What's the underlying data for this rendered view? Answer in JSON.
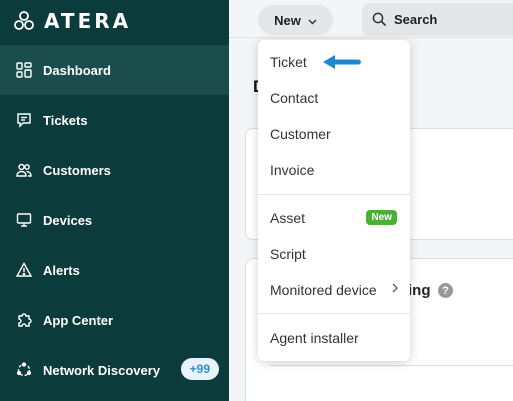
{
  "brand": {
    "name": "ATERA",
    "logo_icon": "atera-trefoil-icon"
  },
  "sidebar": {
    "items": [
      {
        "label": "Dashboard",
        "icon": "dashboard-icon",
        "active": true
      },
      {
        "label": "Tickets",
        "icon": "ticket-chat-icon"
      },
      {
        "label": "Customers",
        "icon": "customers-icon"
      },
      {
        "label": "Devices",
        "icon": "monitor-icon"
      },
      {
        "label": "Alerts",
        "icon": "warning-triangle-icon"
      },
      {
        "label": "App Center",
        "icon": "puzzle-icon"
      },
      {
        "label": "Network Discovery",
        "icon": "network-icon",
        "badge": "+99"
      }
    ]
  },
  "topbar": {
    "new_label": "New",
    "search_label": "Search"
  },
  "main": {
    "heading_fragment": "D",
    "card_title_fragment": "ing",
    "help_glyph": "?"
  },
  "new_menu": {
    "items": [
      {
        "label": "Ticket"
      },
      {
        "label": "Contact"
      },
      {
        "label": "Customer"
      },
      {
        "label": "Invoice"
      },
      {
        "label": "Asset",
        "tag": "New"
      },
      {
        "label": "Script"
      },
      {
        "label": "Monitored device",
        "has_submenu": true
      },
      {
        "label": "Agent installer"
      }
    ]
  },
  "colors": {
    "sidebar_bg": "#0c3b3b",
    "sidebar_active": "#1b4d4d",
    "new_tag": "#4caf35",
    "badge_text": "#2b8fd6",
    "arrow": "#1f86d0"
  }
}
